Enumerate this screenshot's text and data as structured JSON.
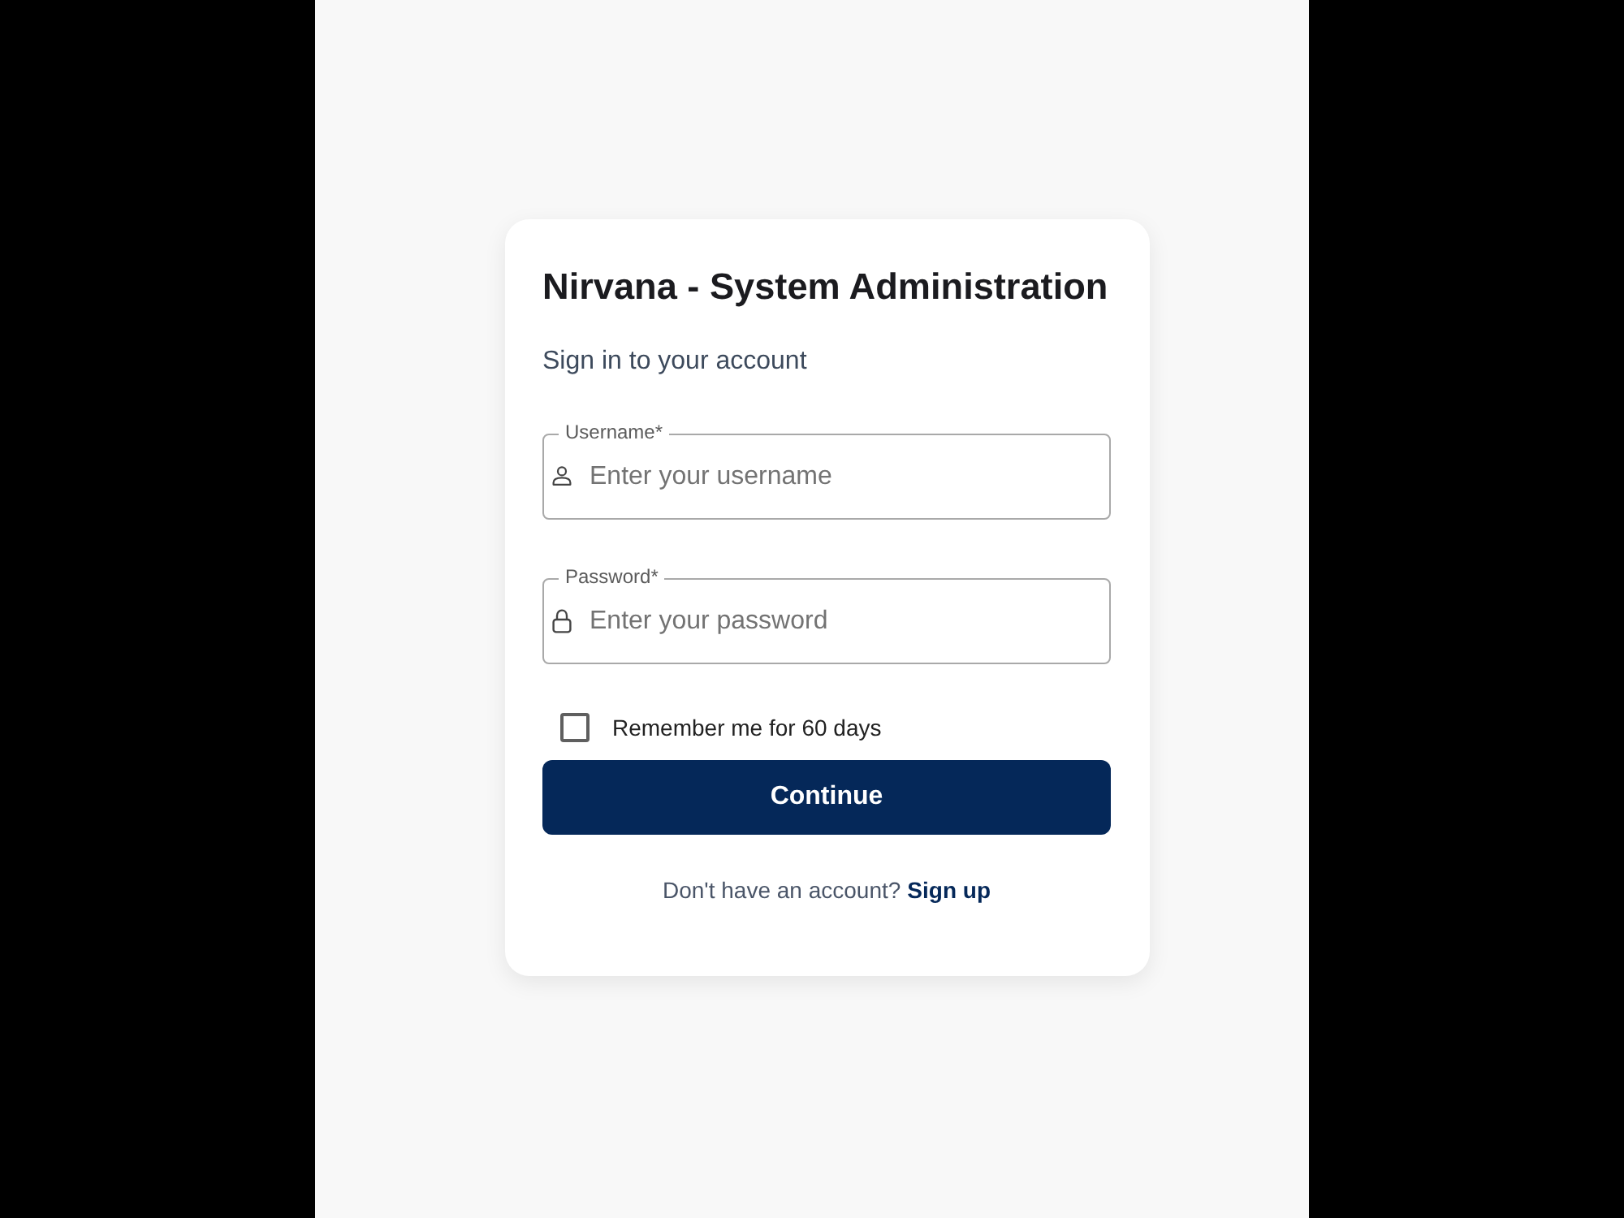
{
  "title": "Nirvana - System Administration",
  "subtitle": "Sign in to your account",
  "fields": [
    {
      "kind": "user",
      "label": "Username*",
      "placeholder": "Enter your username"
    },
    {
      "kind": "lock",
      "label": "Password*",
      "placeholder": "Enter your password"
    }
  ],
  "remember": {
    "label": "Remember me for 60 days",
    "checked": false
  },
  "button": "Continue",
  "footer": {
    "text": "Don't have an account?",
    "link": "Sign up"
  }
}
